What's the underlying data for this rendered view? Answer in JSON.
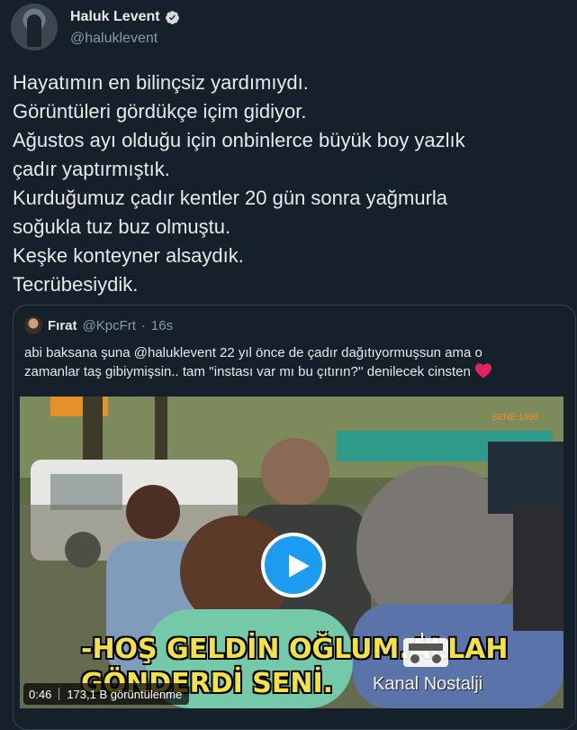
{
  "author": {
    "display_name": "Haluk Levent",
    "handle": "@haluklevent",
    "verified": true
  },
  "tweet": {
    "lines": [
      "Hayatımın en bilinçsiz yardımıydı.",
      "Görüntüleri gördükçe içim gidiyor.",
      "Ağustos ayı olduğu için onbinlerce büyük boy yazlık",
      "çadır yaptırmıştık.",
      "Kurduğumuz çadır kentler 20 gün sonra yağmurla",
      "soğukla tuz buz olmuştu.",
      "Keşke konteyner alsaydık.",
      "Tecrübesiydik."
    ]
  },
  "quoted_tweet": {
    "display_name": "Fırat",
    "handle": "@KpcFrt",
    "separator": "·",
    "time": "16s",
    "text_lines": [
      "abi baksana şuna @haluklevent 22 yıl önce de çadır dağıtıyormuşsun ama o",
      "zamanlar taş gibiymişsin.. tam ''instası var mı bu çıtırın?'' denilecek cinsten"
    ],
    "emoji": "red-heart"
  },
  "video": {
    "subtitle_line1": "-HOŞ GELDİN OĞLUM.ALLAH",
    "subtitle_line2": "GÖNDERDİ SENİ.",
    "channel_watermark": "Kanal Nostalji",
    "date_watermark": "SENE 1999",
    "duration": "0:46",
    "views": "173,1 B görüntülenme"
  },
  "colors": {
    "background": "#15202b",
    "text": "#e7e9ea",
    "secondary_text": "#8b98a5",
    "accent": "#1d9bf0",
    "border": "#38444d",
    "heart": "#f91880"
  }
}
